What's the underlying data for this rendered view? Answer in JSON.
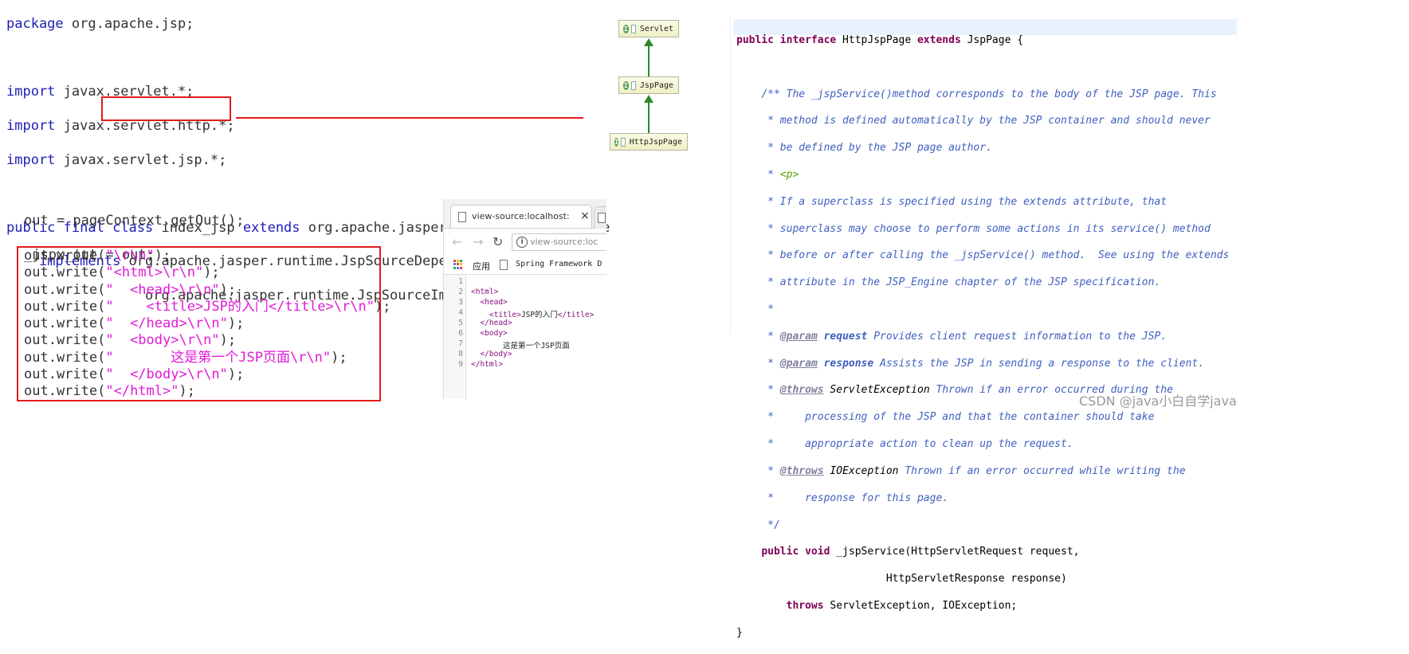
{
  "left_code": {
    "l1_kw": "package",
    "l1_rest": " org.apache.jsp;",
    "l2_kw": "import",
    "l2_rest": " javax.servlet.*;",
    "l3_kw": "import",
    "l3_rest": " javax.servlet.http.*;",
    "l4_kw": "import",
    "l4_rest": " javax.servlet.jsp.*;",
    "l5_kw1": "public final",
    "l5_kw2": "class",
    "l5_cls": " index_jsp",
    "l5_kw3": "extends",
    "l5_rest": " org.apache.jasper.runtime.HttpJspBase",
    "l6_kw": "implements",
    "l6_rest": " org.apache.jasper.runtime.JspSourceDependent,",
    "l7": "org.apache.jasper.runtime.JspSourceImports {",
    "l8": "out = pageContext.getOut();",
    "l9": "_jspx_out = out;"
  },
  "writes": [
    {
      "pre": "out.write(",
      "str": "\"\\r\\n\"",
      "post": ");"
    },
    {
      "pre": "out.write(",
      "str": "\"<html>\\r\\n\"",
      "post": ");"
    },
    {
      "pre": "out.write(",
      "str": "\"  <head>\\r\\n\"",
      "post": ");"
    },
    {
      "pre": "out.write(",
      "str": "\"    <title>JSP的入门</title>\\r\\n\"",
      "post": ");"
    },
    {
      "pre": "out.write(",
      "str": "\"  </head>\\r\\n\"",
      "post": ");"
    },
    {
      "pre": "out.write(",
      "str": "\"  <body>\\r\\n\"",
      "post": ");"
    },
    {
      "pre": "out.write(",
      "str": "\"       这是第一个JSP页面\\r\\n\"",
      "post": ");"
    },
    {
      "pre": "out.write(",
      "str": "\"  </body>\\r\\n\"",
      "post": ");"
    },
    {
      "pre": "out.write(",
      "str": "\"</html>\"",
      "post": ");"
    }
  ],
  "hierarchy": {
    "badge": "I",
    "nodes": [
      "Servlet",
      "JspPage",
      "HttpJspPage"
    ]
  },
  "browser": {
    "tab_title": "view-source:localhost:",
    "tab_close": "×",
    "url": "view-source:loc",
    "info": "i",
    "bookmark_apps": "应用",
    "bookmark_spring": "Spring Framework D",
    "line_numbers": [
      "1",
      "2",
      "3",
      "4",
      "5",
      "6",
      "7",
      "8",
      "9"
    ],
    "source": {
      "l2": "<html>",
      "l3": "<head>",
      "l4_open": "<title>",
      "l4_text": "JSP的入门",
      "l4_close": "</title>",
      "l5": "</head>",
      "l6": "<body>",
      "l7": "这是第一个JSP页面",
      "l8": "</body>",
      "l9": "</html>"
    }
  },
  "java": {
    "decl_kw1": "public interface",
    "decl_name": " HttpJspPage ",
    "decl_kw2": "extends",
    "decl_rest": " JspPage {",
    "c1": "/** The _jspService()method corresponds to the body of the JSP page. This",
    "c2": " * method is defined automatically by the JSP container and should never",
    "c3": " * be defined by the JSP page author.",
    "c4_pre": " * ",
    "c4_tag": "<p>",
    "c5": " * If a superclass is specified using the extends attribute, that",
    "c6": " * superclass may choose to perform some actions in its service() method",
    "c7": " * before or after calling the _jspService() method.  See using the extends",
    "c8": " * attribute in the JSP_Engine chapter of the JSP specification.",
    "c9": " *",
    "p1_tag": "@param",
    "p1_name": "request",
    "p1_desc": " Provides client request information to the JSP.",
    "p2_tag": "@param",
    "p2_name": "response",
    "p2_desc": " Assists the JSP in sending a response to the client.",
    "t1_tag": "@throws",
    "t1_name": " ServletException",
    "t1_desc": " Thrown if an error occurred during the",
    "t1_c2": " *     processing of the JSP and that the container should take",
    "t1_c3": " *     appropriate action to clean up the request.",
    "t2_tag": "@throws",
    "t2_name": " IOException",
    "t2_desc": " Thrown if an error occurred while writing the",
    "t2_c2": " *     response for this page.",
    "cend": " */",
    "m_kw": "public void",
    "m_rest": " _jspService(HttpServletRequest request,",
    "m_l2": "                        HttpServletResponse response)",
    "th_kw": "throws",
    "th_rest": " ServletException, IOException;",
    "close": "}"
  },
  "watermark": "CSDN @java小白自学java"
}
